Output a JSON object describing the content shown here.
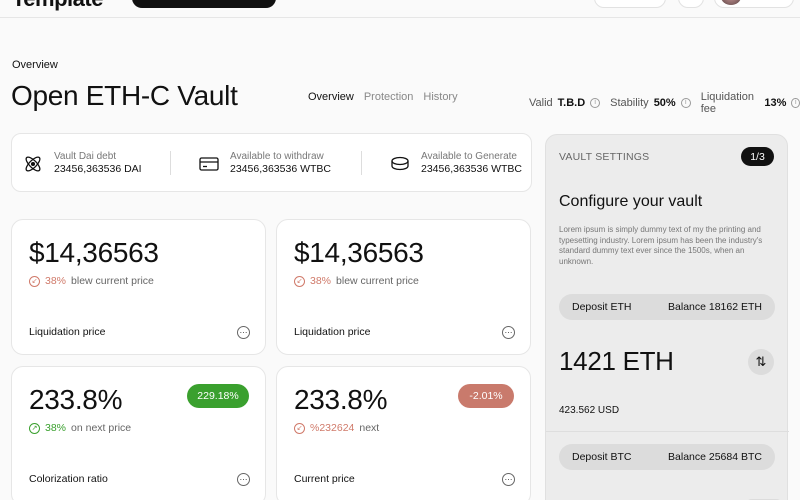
{
  "header": {
    "logo": "Template"
  },
  "breadcrumb": "Overview",
  "title": "Open ETH-C Vault",
  "tabs": [
    {
      "label": "Overview",
      "active": true
    },
    {
      "label": "Protection",
      "active": false
    },
    {
      "label": "History",
      "active": false
    }
  ],
  "stats": [
    {
      "label": "Valid",
      "value": "T.B.D"
    },
    {
      "label": "Stability",
      "value": "50%"
    },
    {
      "label": "Liquidation fee",
      "value": "13%"
    }
  ],
  "summary": [
    {
      "label": "Vault Dai debt",
      "value": "23456,363536 DAI",
      "icon": "atom-icon"
    },
    {
      "label": "Available to withdraw",
      "value": "23456,363536 WTBC",
      "icon": "card-icon"
    },
    {
      "label": "Available to Generate",
      "value": "23456,363536 WTBC",
      "icon": "coins-icon"
    }
  ],
  "cards": [
    {
      "value": "$14,36563",
      "pct": "38%",
      "pct_text": "blew current price",
      "trend": "down",
      "label": "Liquidation price"
    },
    {
      "value": "$14,36563",
      "pct": "38%",
      "pct_text": "blew current price",
      "trend": "down",
      "label": "Liquidation price"
    },
    {
      "value": "233.8%",
      "pct": "38%",
      "pct_text": "on next price",
      "trend": "up",
      "label": "Colorization ratio",
      "badge": "229.18%",
      "badge_color": "#3aa02e"
    },
    {
      "value": "233.8%",
      "pct": "%232624",
      "pct_text": "next",
      "trend": "down",
      "label": "Current price",
      "badge": "-2.01%",
      "badge_color": "#c97a6c"
    }
  ],
  "settings": {
    "heading": "VAULT SETTINGS",
    "step": "1/3",
    "title": "Configure your vault",
    "description": "Lorem ipsum is simply dummy text of my the printing and typesetting industry. Lorem ipsum has been the industry's standard dummy text ever since the 1500s, when an unknown.",
    "deposit_eth": {
      "label": "Deposit ETH",
      "balance": "Balance 18162 ETH"
    },
    "eth_amount": "1421 ETH",
    "usd_amount": "423.562 USD",
    "deposit_btc": {
      "label": "Deposit BTC",
      "balance": "Balance 25684 BTC"
    }
  },
  "colors": {
    "accent_dark": "#111111",
    "positive": "#3aa02e",
    "negative": "#d07a6a",
    "panel_bg": "#ececec"
  }
}
